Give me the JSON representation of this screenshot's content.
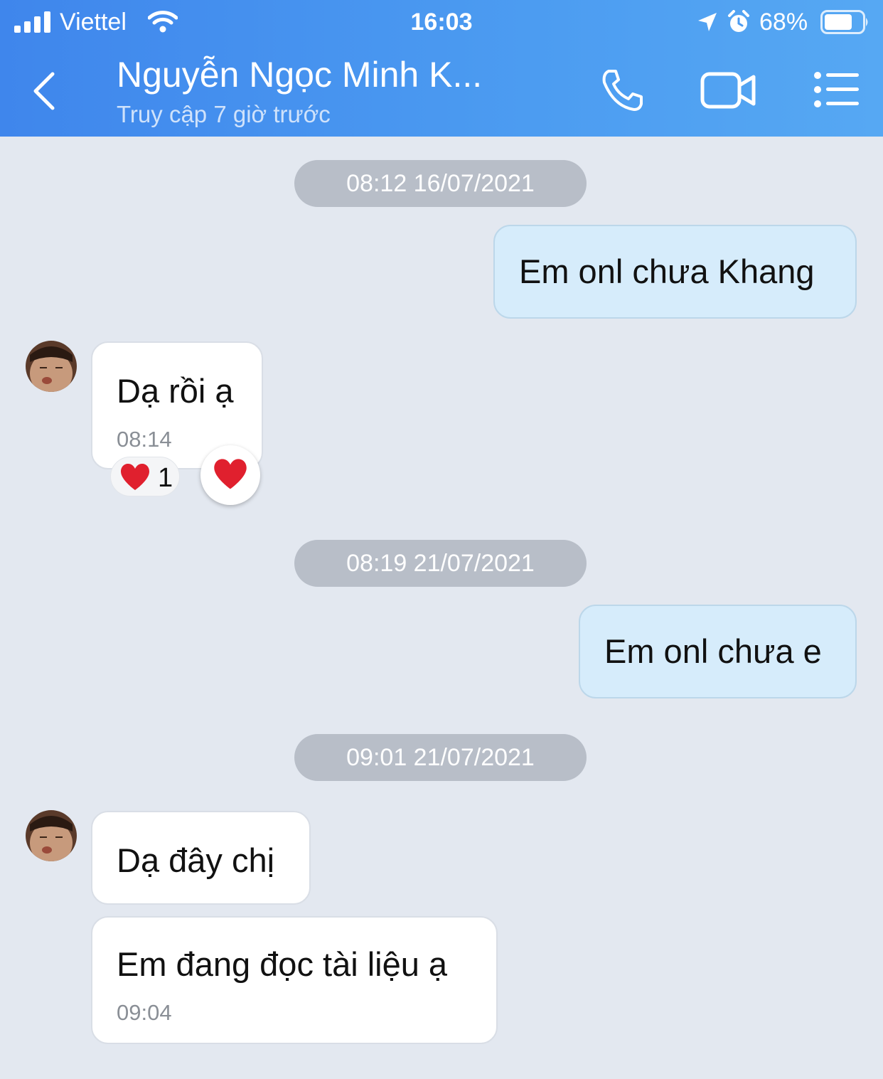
{
  "status_bar": {
    "carrier": "Viettel",
    "time": "16:03",
    "battery": "68%"
  },
  "header": {
    "contact_name": "Nguyễn Ngọc Minh K...",
    "last_seen": "Truy cập 7 giờ trước"
  },
  "conversation": {
    "timestamps": [
      "08:12 16/07/2021",
      "08:19 21/07/2021",
      "09:01 21/07/2021"
    ],
    "messages": [
      {
        "direction": "out",
        "text": "Em onl chưa Khang"
      },
      {
        "direction": "in",
        "text": "Dạ rồi ạ",
        "time": "08:14",
        "reaction_count": "1"
      },
      {
        "direction": "out",
        "text": "Em onl chưa e"
      },
      {
        "direction": "in",
        "text": "Dạ đây chị"
      },
      {
        "direction": "in",
        "text": "Em đang đọc tài liệu ạ",
        "time": "09:04"
      }
    ]
  },
  "icons": {
    "back": "chevron-left-icon",
    "call": "phone-icon",
    "video": "video-camera-icon",
    "menu": "list-menu-icon",
    "reaction": "heart-icon"
  },
  "colors": {
    "header_start": "#3f86ec",
    "header_end": "#56a8f3",
    "background": "#e3e8f0",
    "outgoing_bubble": "#d6ecfb",
    "incoming_bubble": "#ffffff",
    "timestamp_pill": "#b8bec8",
    "heart": "#e0202e"
  }
}
